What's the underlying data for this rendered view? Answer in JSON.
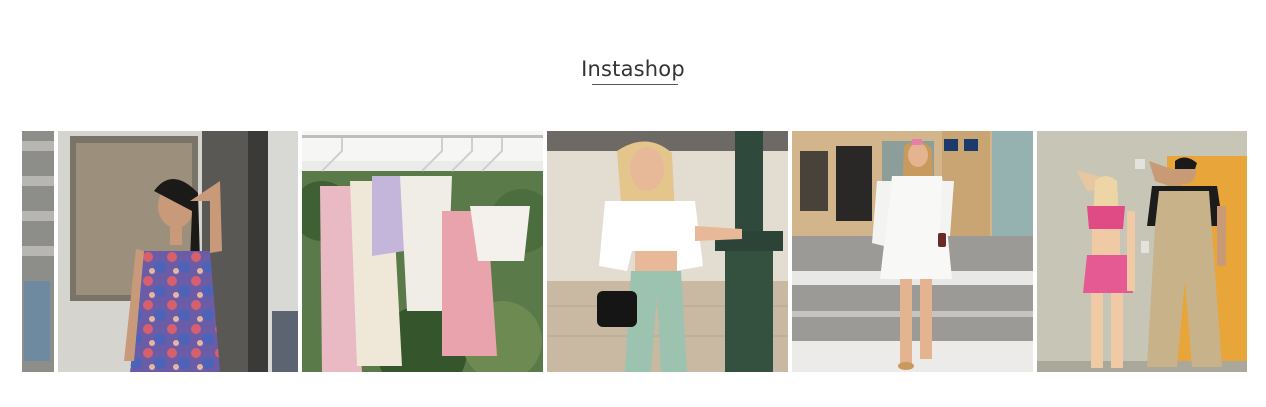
{
  "section": {
    "title": "Instashop"
  },
  "gallery": {
    "posts": [
      {
        "photo": "woman-in-floral-dress-photo"
      },
      {
        "photo": "hanging-dresses-on-rack-photo"
      },
      {
        "photo": "woman-in-white-shirt-by-lamppost-photo"
      },
      {
        "photo": "woman-in-white-dress-on-street-photo"
      },
      {
        "photo": "two-people-posing-indoors-photo"
      }
    ]
  }
}
